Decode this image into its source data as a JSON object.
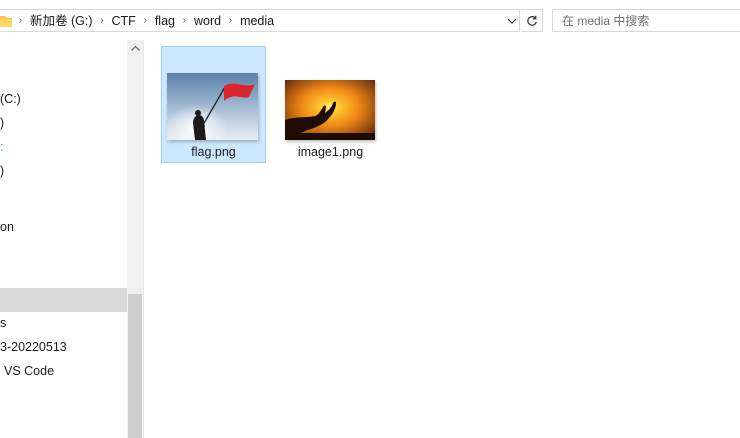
{
  "address_bar": {
    "breadcrumbs": [
      "新加卷 (G:)",
      "CTF",
      "flag",
      "word",
      "media"
    ],
    "separator": "›",
    "dropdown_icon": "chevron-down-icon",
    "refresh_icon": "refresh-icon"
  },
  "search": {
    "placeholder": "在 media 中搜索"
  },
  "nav": {
    "items": [
      {
        "label": "(C:)"
      },
      {
        "label": ")"
      },
      {
        "label": ":"
      },
      {
        "label": ")"
      },
      {
        "label": "on"
      },
      {
        "label": ""
      },
      {
        "label": "s"
      },
      {
        "label": "3-20220513"
      },
      {
        "label": "VS Code"
      }
    ]
  },
  "files": [
    {
      "name": "flag.png",
      "selected": true,
      "thumbnail": "red-flag-sky-photo"
    },
    {
      "name": "image1.png",
      "selected": false,
      "thumbnail": "sunset-hand-photo"
    }
  ],
  "colors": {
    "selection_bg": "#cce8ff",
    "selection_border": "#99d1ff",
    "nav_selected": "#d9d9d9",
    "cyan_text": "#2ba7c4"
  }
}
